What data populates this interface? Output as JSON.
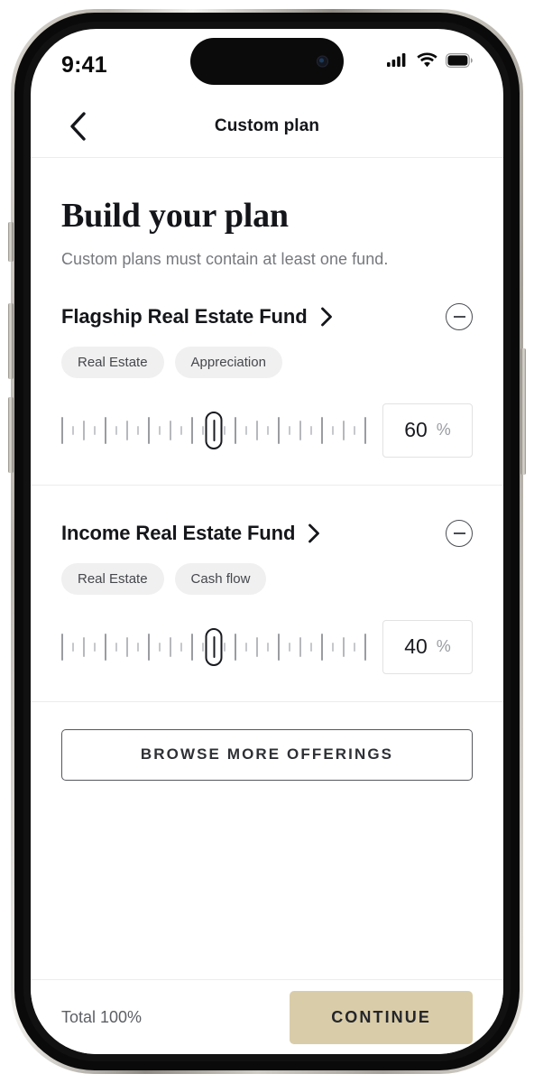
{
  "status_bar": {
    "time": "9:41",
    "cellular_icon": "signal-bars-icon",
    "wifi_icon": "wifi-icon",
    "battery_icon": "battery-icon"
  },
  "nav": {
    "back_icon": "chevron-left-icon",
    "title": "Custom plan"
  },
  "hero": {
    "title": "Build your plan",
    "subtitle": "Custom plans must contain at least one fund."
  },
  "funds": [
    {
      "name": "Flagship Real Estate Fund",
      "disclosure_icon": "chevron-right-icon",
      "remove_icon": "minus-circle-icon",
      "tags": [
        "Real Estate",
        "Appreciation"
      ],
      "allocation": "60",
      "percent_symbol": "%",
      "slider": {
        "min": 0,
        "max": 100,
        "value": 60,
        "thumb_position_pct": 50
      }
    },
    {
      "name": "Income Real Estate Fund",
      "disclosure_icon": "chevron-right-icon",
      "remove_icon": "minus-circle-icon",
      "tags": [
        "Real Estate",
        "Cash flow"
      ],
      "allocation": "40",
      "percent_symbol": "%",
      "slider": {
        "min": 0,
        "max": 100,
        "value": 40,
        "thumb_position_pct": 50
      }
    }
  ],
  "browse_button": {
    "label": "BROWSE MORE OFFERINGS"
  },
  "footer": {
    "total_label": "Total 100%",
    "continue_label": "CONTINUE",
    "continue_bg": "#d9cca8"
  },
  "colors": {
    "accent": "#d9cca8",
    "text_primary": "#15161a",
    "text_secondary": "#76787d",
    "tag_bg": "#f0f0f0",
    "divider": "#ececec"
  }
}
